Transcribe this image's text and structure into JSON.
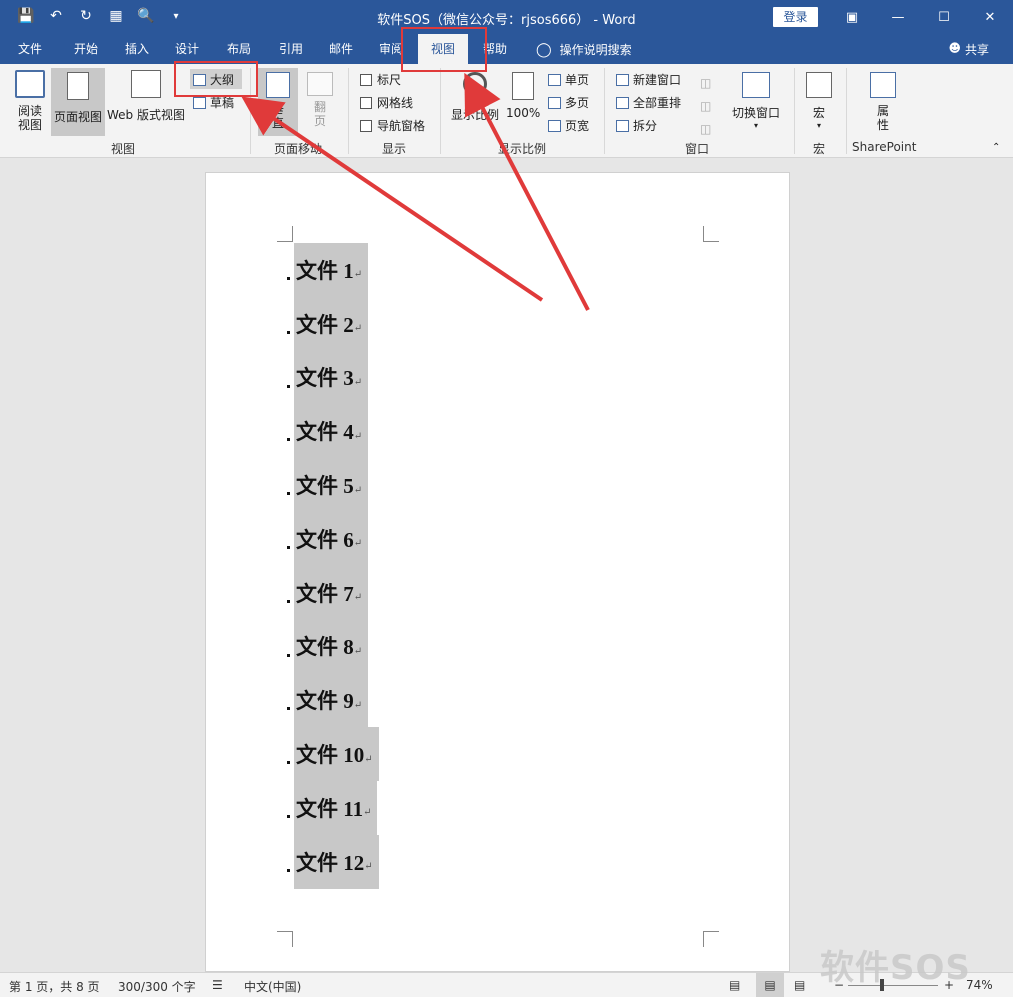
{
  "title": {
    "text": "软件SOS（微信公众号：rjsos666） - Word",
    "login": "登录"
  },
  "qat": {
    "icons": [
      "save-icon",
      "undo-icon",
      "redo-icon",
      "touch-mode-icon",
      "print-preview-icon",
      "customize-icon"
    ]
  },
  "tabs": [
    "文件",
    "开始",
    "插入",
    "设计",
    "布局",
    "引用",
    "邮件",
    "审阅",
    "视图",
    "帮助"
  ],
  "active_tab": "视图",
  "tell_me": "操作说明搜索",
  "share": "共享",
  "ribbon": {
    "views": {
      "read_mode_1": "阅读",
      "read_mode_2": "视图",
      "print_layout": "页面视图",
      "web_layout": "Web 版式视图",
      "outline": "大纲",
      "draft": "草稿",
      "group": "视图"
    },
    "page_movement": {
      "vertical_1": "垂",
      "vertical_2": "直",
      "side_1": "翻",
      "side_2": "页",
      "group": "页面移动"
    },
    "show": {
      "ruler": "标尺",
      "gridlines": "网格线",
      "nav_pane": "导航窗格",
      "group": "显示"
    },
    "zoom": {
      "zoom": "显示比例",
      "hundred": "100%",
      "one_page": "单页",
      "multi_page": "多页",
      "page_width": "页宽",
      "group": "显示比例"
    },
    "window": {
      "new_window": "新建窗口",
      "arrange_all": "全部重排",
      "split": "拆分",
      "switch": "切换窗口",
      "group": "窗口"
    },
    "macros": {
      "label": "宏",
      "group": "宏"
    },
    "sharepoint": {
      "prop_1": "属",
      "prop_2": "性",
      "group": "SharePoint"
    }
  },
  "document": {
    "headings": [
      "文件 1",
      "文件 2",
      "文件 3",
      "文件 4",
      "文件 5",
      "文件 6",
      "文件 7",
      "文件 8",
      "文件 9",
      "文件 10",
      "文件 11",
      "文件 12"
    ]
  },
  "status": {
    "page": "第 1 页，共 8 页",
    "words": "300/300 个字",
    "language": "中文(中国)",
    "zoom": "74%"
  },
  "watermark": "软件SOS",
  "colors": {
    "titlebar": "#2b579a",
    "highlight": "#c8c8c8",
    "annotation": "#e03a3a"
  }
}
